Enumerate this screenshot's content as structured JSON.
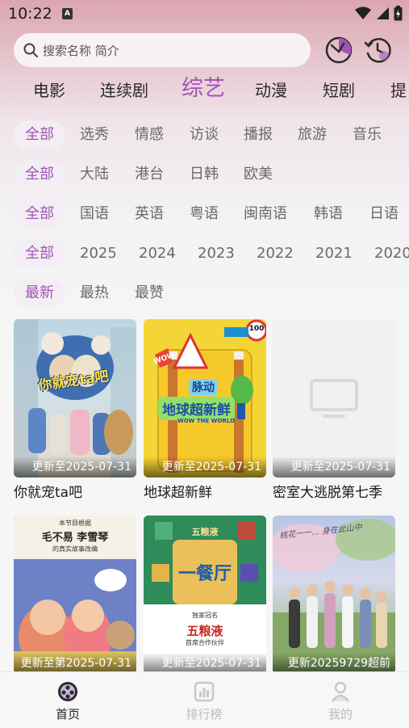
{
  "status_bar": {
    "time": "10:22",
    "notification_icon": "A"
  },
  "search": {
    "placeholder": "搜索名称 简介"
  },
  "categories": [
    {
      "label": "电影",
      "active": false
    },
    {
      "label": "连续剧",
      "active": false
    },
    {
      "label": "综艺",
      "active": true
    },
    {
      "label": "动漫",
      "active": false
    },
    {
      "label": "短剧",
      "active": false
    },
    {
      "label": "提",
      "active": false
    }
  ],
  "filters": {
    "type": [
      "全部",
      "选秀",
      "情感",
      "访谈",
      "播报",
      "旅游",
      "音乐"
    ],
    "region": [
      "全部",
      "大陆",
      "港台",
      "日韩",
      "欧美"
    ],
    "language": [
      "全部",
      "国语",
      "英语",
      "粤语",
      "闽南语",
      "韩语",
      "日语"
    ],
    "year": [
      "全部",
      "2025",
      "2024",
      "2023",
      "2022",
      "2021",
      "2020"
    ],
    "sort": [
      "最新",
      "最热",
      "最赞"
    ]
  },
  "items": [
    {
      "title": "你就宠ta吧",
      "update": "更新至2025-07-31"
    },
    {
      "title": "地球超新鲜",
      "update": "更新至2025-07-31"
    },
    {
      "title": "密室大逃脱第七季",
      "update": "更新至2025-07-31"
    },
    {
      "title": "",
      "update": "更新至第2025-07-31"
    },
    {
      "title": "",
      "update": "更新至2025-07-31"
    },
    {
      "title": "",
      "update": "更新20259729超前"
    }
  ],
  "poster_texts": {
    "p1_logo": "你就宠ta吧",
    "p2_brand": "脉动",
    "p2_logo": "地球超新鲜",
    "p2_sub": "WOW THE WORLD",
    "p2_sign_num": "100",
    "p2_wow": "WOW",
    "p4_top": "本节目根据",
    "p4_names": "毛不易  李雪琴",
    "p4_sub": "的真实故事改编",
    "p5_brand": "五粮液",
    "p5_logo": "一餐厅",
    "p5_sponsor1": "独家冠名",
    "p5_sponsor2": "首席合作伙伴",
    "p6_script": "桃花一一... 身在此山中"
  },
  "bottom_nav": [
    {
      "label": "首页",
      "icon": "home-film-icon",
      "active": true
    },
    {
      "label": "排行榜",
      "icon": "ranking-icon",
      "active": false
    },
    {
      "label": "我的",
      "icon": "profile-icon",
      "active": false
    }
  ],
  "colors": {
    "accent": "#a154b5",
    "chip_active_bg": "#f2eef3"
  }
}
